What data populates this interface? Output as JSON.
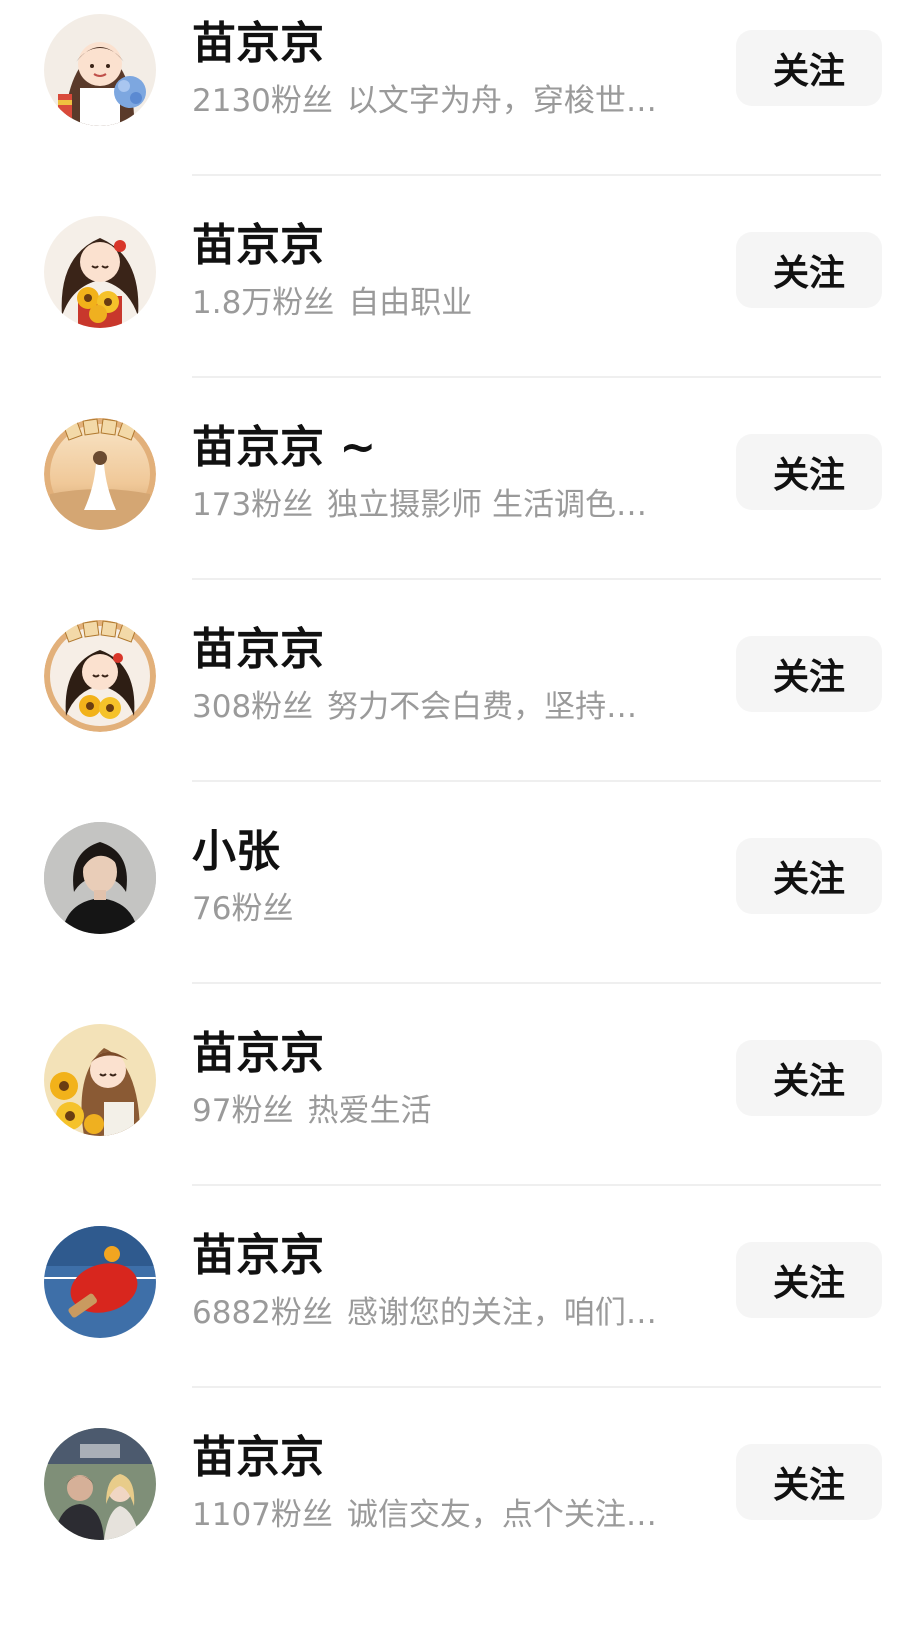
{
  "users": [
    {
      "name": "苗京京",
      "fans": "2130粉丝",
      "bio": "以文字为舟，穿梭世…",
      "follow_label": "关注",
      "avatar_icon": "cartoon-girl-hydrangea-avatar"
    },
    {
      "name": "苗京京",
      "fans": "1.8万粉丝",
      "bio": "自由职业",
      "follow_label": "关注",
      "avatar_icon": "cartoon-girl-sunflower-avatar"
    },
    {
      "name": "苗京京 ~",
      "fans": "173粉丝",
      "bio": "独立摄影师 生活调色…",
      "follow_label": "关注",
      "avatar_icon": "beach-girl-toutiao-daren-avatar"
    },
    {
      "name": "苗京京",
      "fans": "308粉丝",
      "bio": "努力不会白费，坚持…",
      "follow_label": "关注",
      "avatar_icon": "cartoon-girl-toutiao-daren-avatar"
    },
    {
      "name": "小张",
      "fans": "76粉丝",
      "bio": "",
      "follow_label": "关注",
      "avatar_icon": "woman-portrait-avatar"
    },
    {
      "name": "苗京京",
      "fans": "97粉丝",
      "bio": "热爱生活",
      "follow_label": "关注",
      "avatar_icon": "cartoon-girl-sunflower-field-avatar"
    },
    {
      "name": "苗京京",
      "fans": "6882粉丝",
      "bio": "感谢您的关注，咱们…",
      "follow_label": "关注",
      "avatar_icon": "ping-pong-paddle-avatar"
    },
    {
      "name": "苗京京",
      "fans": "1107粉丝",
      "bio": "诚信交友，点个关注…",
      "follow_label": "关注",
      "avatar_icon": "couple-photo-avatar"
    }
  ],
  "colors": {
    "name": "#111111",
    "subtitle": "#9a9a9a",
    "button_bg": "#f5f5f5",
    "divider": "#efefef"
  }
}
